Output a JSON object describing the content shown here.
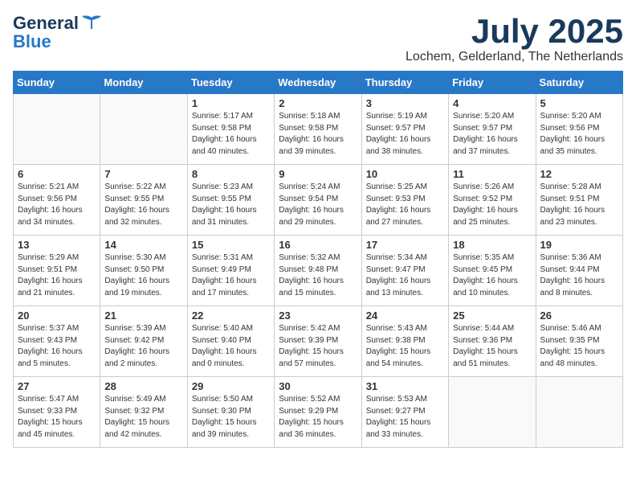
{
  "header": {
    "logo_line1": "General",
    "logo_line2": "Blue",
    "month_title": "July 2025",
    "location": "Lochem, Gelderland, The Netherlands"
  },
  "weekdays": [
    "Sunday",
    "Monday",
    "Tuesday",
    "Wednesday",
    "Thursday",
    "Friday",
    "Saturday"
  ],
  "weeks": [
    [
      {
        "day": "",
        "info": ""
      },
      {
        "day": "",
        "info": ""
      },
      {
        "day": "1",
        "info": "Sunrise: 5:17 AM\nSunset: 9:58 PM\nDaylight: 16 hours\nand 40 minutes."
      },
      {
        "day": "2",
        "info": "Sunrise: 5:18 AM\nSunset: 9:58 PM\nDaylight: 16 hours\nand 39 minutes."
      },
      {
        "day": "3",
        "info": "Sunrise: 5:19 AM\nSunset: 9:57 PM\nDaylight: 16 hours\nand 38 minutes."
      },
      {
        "day": "4",
        "info": "Sunrise: 5:20 AM\nSunset: 9:57 PM\nDaylight: 16 hours\nand 37 minutes."
      },
      {
        "day": "5",
        "info": "Sunrise: 5:20 AM\nSunset: 9:56 PM\nDaylight: 16 hours\nand 35 minutes."
      }
    ],
    [
      {
        "day": "6",
        "info": "Sunrise: 5:21 AM\nSunset: 9:56 PM\nDaylight: 16 hours\nand 34 minutes."
      },
      {
        "day": "7",
        "info": "Sunrise: 5:22 AM\nSunset: 9:55 PM\nDaylight: 16 hours\nand 32 minutes."
      },
      {
        "day": "8",
        "info": "Sunrise: 5:23 AM\nSunset: 9:55 PM\nDaylight: 16 hours\nand 31 minutes."
      },
      {
        "day": "9",
        "info": "Sunrise: 5:24 AM\nSunset: 9:54 PM\nDaylight: 16 hours\nand 29 minutes."
      },
      {
        "day": "10",
        "info": "Sunrise: 5:25 AM\nSunset: 9:53 PM\nDaylight: 16 hours\nand 27 minutes."
      },
      {
        "day": "11",
        "info": "Sunrise: 5:26 AM\nSunset: 9:52 PM\nDaylight: 16 hours\nand 25 minutes."
      },
      {
        "day": "12",
        "info": "Sunrise: 5:28 AM\nSunset: 9:51 PM\nDaylight: 16 hours\nand 23 minutes."
      }
    ],
    [
      {
        "day": "13",
        "info": "Sunrise: 5:29 AM\nSunset: 9:51 PM\nDaylight: 16 hours\nand 21 minutes."
      },
      {
        "day": "14",
        "info": "Sunrise: 5:30 AM\nSunset: 9:50 PM\nDaylight: 16 hours\nand 19 minutes."
      },
      {
        "day": "15",
        "info": "Sunrise: 5:31 AM\nSunset: 9:49 PM\nDaylight: 16 hours\nand 17 minutes."
      },
      {
        "day": "16",
        "info": "Sunrise: 5:32 AM\nSunset: 9:48 PM\nDaylight: 16 hours\nand 15 minutes."
      },
      {
        "day": "17",
        "info": "Sunrise: 5:34 AM\nSunset: 9:47 PM\nDaylight: 16 hours\nand 13 minutes."
      },
      {
        "day": "18",
        "info": "Sunrise: 5:35 AM\nSunset: 9:45 PM\nDaylight: 16 hours\nand 10 minutes."
      },
      {
        "day": "19",
        "info": "Sunrise: 5:36 AM\nSunset: 9:44 PM\nDaylight: 16 hours\nand 8 minutes."
      }
    ],
    [
      {
        "day": "20",
        "info": "Sunrise: 5:37 AM\nSunset: 9:43 PM\nDaylight: 16 hours\nand 5 minutes."
      },
      {
        "day": "21",
        "info": "Sunrise: 5:39 AM\nSunset: 9:42 PM\nDaylight: 16 hours\nand 2 minutes."
      },
      {
        "day": "22",
        "info": "Sunrise: 5:40 AM\nSunset: 9:40 PM\nDaylight: 16 hours\nand 0 minutes."
      },
      {
        "day": "23",
        "info": "Sunrise: 5:42 AM\nSunset: 9:39 PM\nDaylight: 15 hours\nand 57 minutes."
      },
      {
        "day": "24",
        "info": "Sunrise: 5:43 AM\nSunset: 9:38 PM\nDaylight: 15 hours\nand 54 minutes."
      },
      {
        "day": "25",
        "info": "Sunrise: 5:44 AM\nSunset: 9:36 PM\nDaylight: 15 hours\nand 51 minutes."
      },
      {
        "day": "26",
        "info": "Sunrise: 5:46 AM\nSunset: 9:35 PM\nDaylight: 15 hours\nand 48 minutes."
      }
    ],
    [
      {
        "day": "27",
        "info": "Sunrise: 5:47 AM\nSunset: 9:33 PM\nDaylight: 15 hours\nand 45 minutes."
      },
      {
        "day": "28",
        "info": "Sunrise: 5:49 AM\nSunset: 9:32 PM\nDaylight: 15 hours\nand 42 minutes."
      },
      {
        "day": "29",
        "info": "Sunrise: 5:50 AM\nSunset: 9:30 PM\nDaylight: 15 hours\nand 39 minutes."
      },
      {
        "day": "30",
        "info": "Sunrise: 5:52 AM\nSunset: 9:29 PM\nDaylight: 15 hours\nand 36 minutes."
      },
      {
        "day": "31",
        "info": "Sunrise: 5:53 AM\nSunset: 9:27 PM\nDaylight: 15 hours\nand 33 minutes."
      },
      {
        "day": "",
        "info": ""
      },
      {
        "day": "",
        "info": ""
      }
    ]
  ]
}
